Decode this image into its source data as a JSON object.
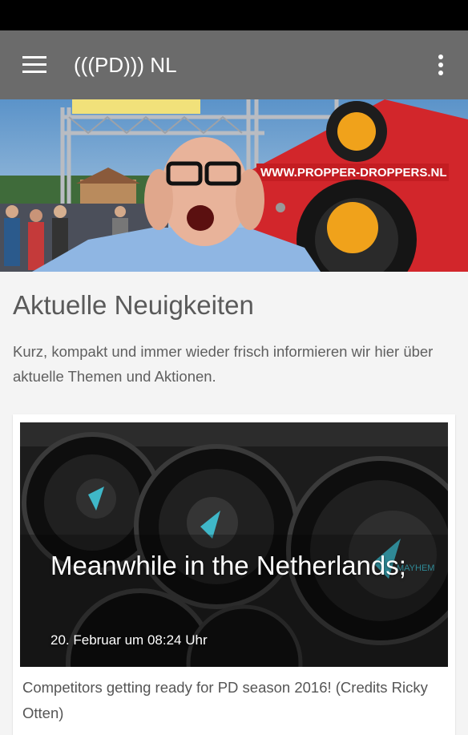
{
  "app_bar": {
    "title": "(((PD))) NL",
    "menu_icon": "hamburger-menu-icon",
    "overflow_icon": "more-vert-icon",
    "background": "#6b6b6b"
  },
  "hero": {
    "banner_text": "WWW.PROPPER-DROPPERS.NL"
  },
  "section": {
    "title": "Aktuelle Neuigkeiten",
    "description": "Kurz, kompakt und immer wieder frisch informieren wir hier über aktuelle Themen und Aktionen."
  },
  "news": [
    {
      "headline": "Meanwhile in the Netherlands;",
      "date": "20. Februar um 08:24 Uhr",
      "text": "Competitors getting ready for PD season 2016! (Credits Ricky Otten)",
      "speaker_brand": "MAYHEM"
    }
  ]
}
